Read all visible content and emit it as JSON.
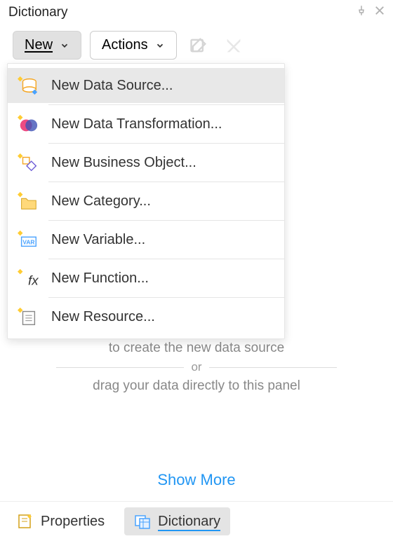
{
  "header": {
    "title": "Dictionary"
  },
  "toolbar": {
    "new_label": "New",
    "actions_label": "Actions"
  },
  "menu": {
    "items": [
      {
        "label": "New Data Source...",
        "icon": "database-sparkle-icon",
        "highlight": true
      },
      {
        "label": "New Data Transformation...",
        "icon": "venn-sparkle-icon",
        "highlight": false
      },
      {
        "label": "New Business Object...",
        "icon": "blocks-sparkle-icon",
        "highlight": false
      },
      {
        "label": "New Category...",
        "icon": "folder-sparkle-icon",
        "highlight": false
      },
      {
        "label": "New Variable...",
        "icon": "variable-sparkle-icon",
        "highlight": false
      },
      {
        "label": "New Function...",
        "icon": "function-sparkle-icon",
        "highlight": false
      },
      {
        "label": "New Resource...",
        "icon": "resource-sparkle-icon",
        "highlight": false
      }
    ]
  },
  "hints": {
    "line1": "to create the new data source",
    "or": "or",
    "line2": "drag your data directly to this panel"
  },
  "show_more": "Show More",
  "tabs": {
    "properties": "Properties",
    "dictionary": "Dictionary"
  }
}
